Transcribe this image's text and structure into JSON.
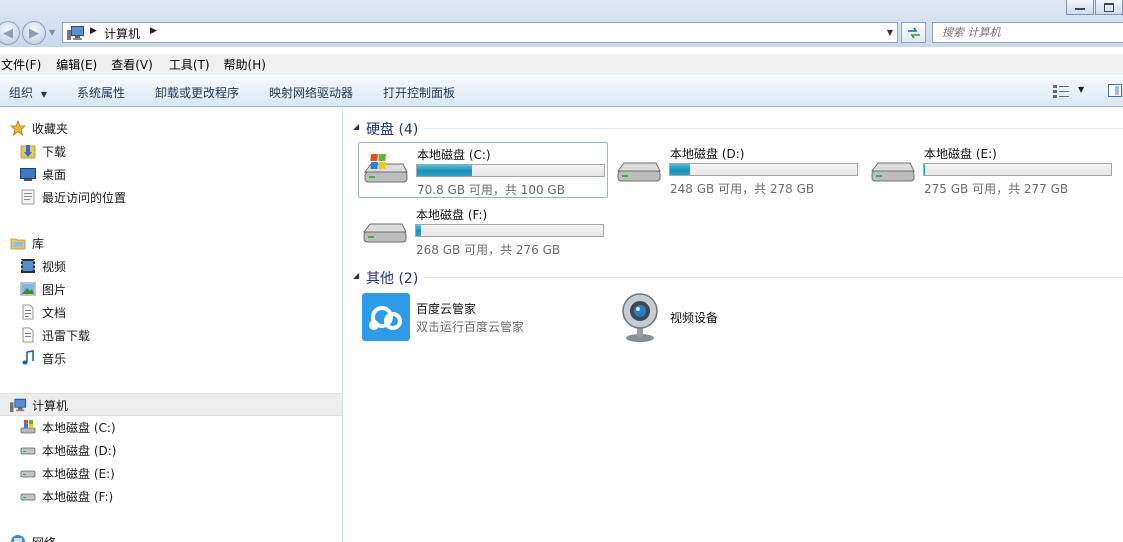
{
  "address": {
    "path": "计算机",
    "search_placeholder": "搜索 计算机"
  },
  "menu": [
    "文件(F)",
    "编辑(E)",
    "查看(V)",
    "工具(T)",
    "帮助(H)"
  ],
  "toolbar": {
    "organize": "组织",
    "system_properties": "系统属性",
    "uninstall": "卸载或更改程序",
    "map_drive": "映射网络驱动器",
    "control_panel": "打开控制面板"
  },
  "nav": {
    "favorites": "收藏夹",
    "downloads": "下载",
    "desktop": "桌面",
    "recent": "最近访问的位置",
    "libraries": "库",
    "videos": "视频",
    "pictures": "图片",
    "documents": "文档",
    "xunlei": "迅雷下载",
    "music": "音乐",
    "computer": "计算机",
    "drive_c": "本地磁盘 (C:)",
    "drive_d": "本地磁盘 (D:)",
    "drive_e": "本地磁盘 (E:)",
    "drive_f": "本地磁盘 (F:)",
    "network": "网络"
  },
  "groups": {
    "hard_disks": "硬盘 (4)",
    "other": "其他 (2)"
  },
  "drives": [
    {
      "name": "本地磁盘 (C:)",
      "free_text": "70.8 GB 可用，共 100 GB",
      "used_fraction": 0.292
    },
    {
      "name": "本地磁盘 (D:)",
      "free_text": "248 GB 可用，共 278 GB",
      "used_fraction": 0.108
    },
    {
      "name": "本地磁盘 (E:)",
      "free_text": "275 GB 可用，共 277 GB",
      "used_fraction": 0.007
    },
    {
      "name": "本地磁盘 (F:)",
      "free_text": "268 GB 可用，共 276 GB",
      "used_fraction": 0.029
    }
  ],
  "others": {
    "baidu_name": "百度云管家",
    "baidu_desc": "双击运行百度云管家",
    "webcam_name": "视频设备"
  },
  "colors": {
    "accent_blue": "#1e3287",
    "bar_fill": "#1a8fb4",
    "baidu_blue": "#2f9be8"
  },
  "icons": [
    "star-icon",
    "folder-download-icon",
    "desktop-icon",
    "recent-places-icon",
    "library-icon",
    "video-icon",
    "picture-icon",
    "document-icon",
    "music-icon",
    "computer-icon",
    "drive-icon",
    "windows-drive-icon",
    "network-icon",
    "baidu-cloud-icon",
    "webcam-icon",
    "refresh-icon"
  ]
}
